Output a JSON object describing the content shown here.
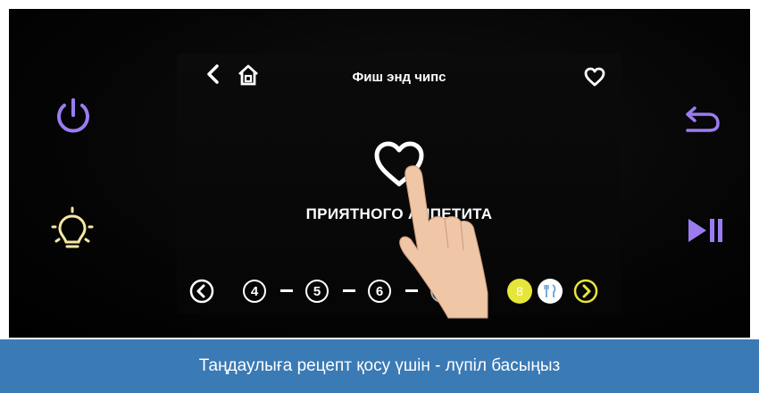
{
  "screen": {
    "title": "Фиш энд чипс",
    "message": "ПРИЯТНОГО АППЕТИТА",
    "steps": [
      "4",
      "5",
      "6",
      "7",
      "8"
    ]
  },
  "caption": "Таңдаулыға рецепт қосу үшін - лүпіл басыңыз",
  "colors": {
    "accent_purple": "#9b7cf0",
    "light_yellow": "#f5e7a1",
    "step_active": "#e6e63a",
    "caption_bg": "#3a7ab5"
  },
  "icons": {
    "power": "power-icon",
    "light": "light-bulb-icon",
    "undo": "return-icon",
    "play_pause": "play-pause-icon",
    "back": "chevron-left-icon",
    "home": "home-icon",
    "favorite": "heart-icon",
    "utensils": "fork-knife-icon"
  }
}
